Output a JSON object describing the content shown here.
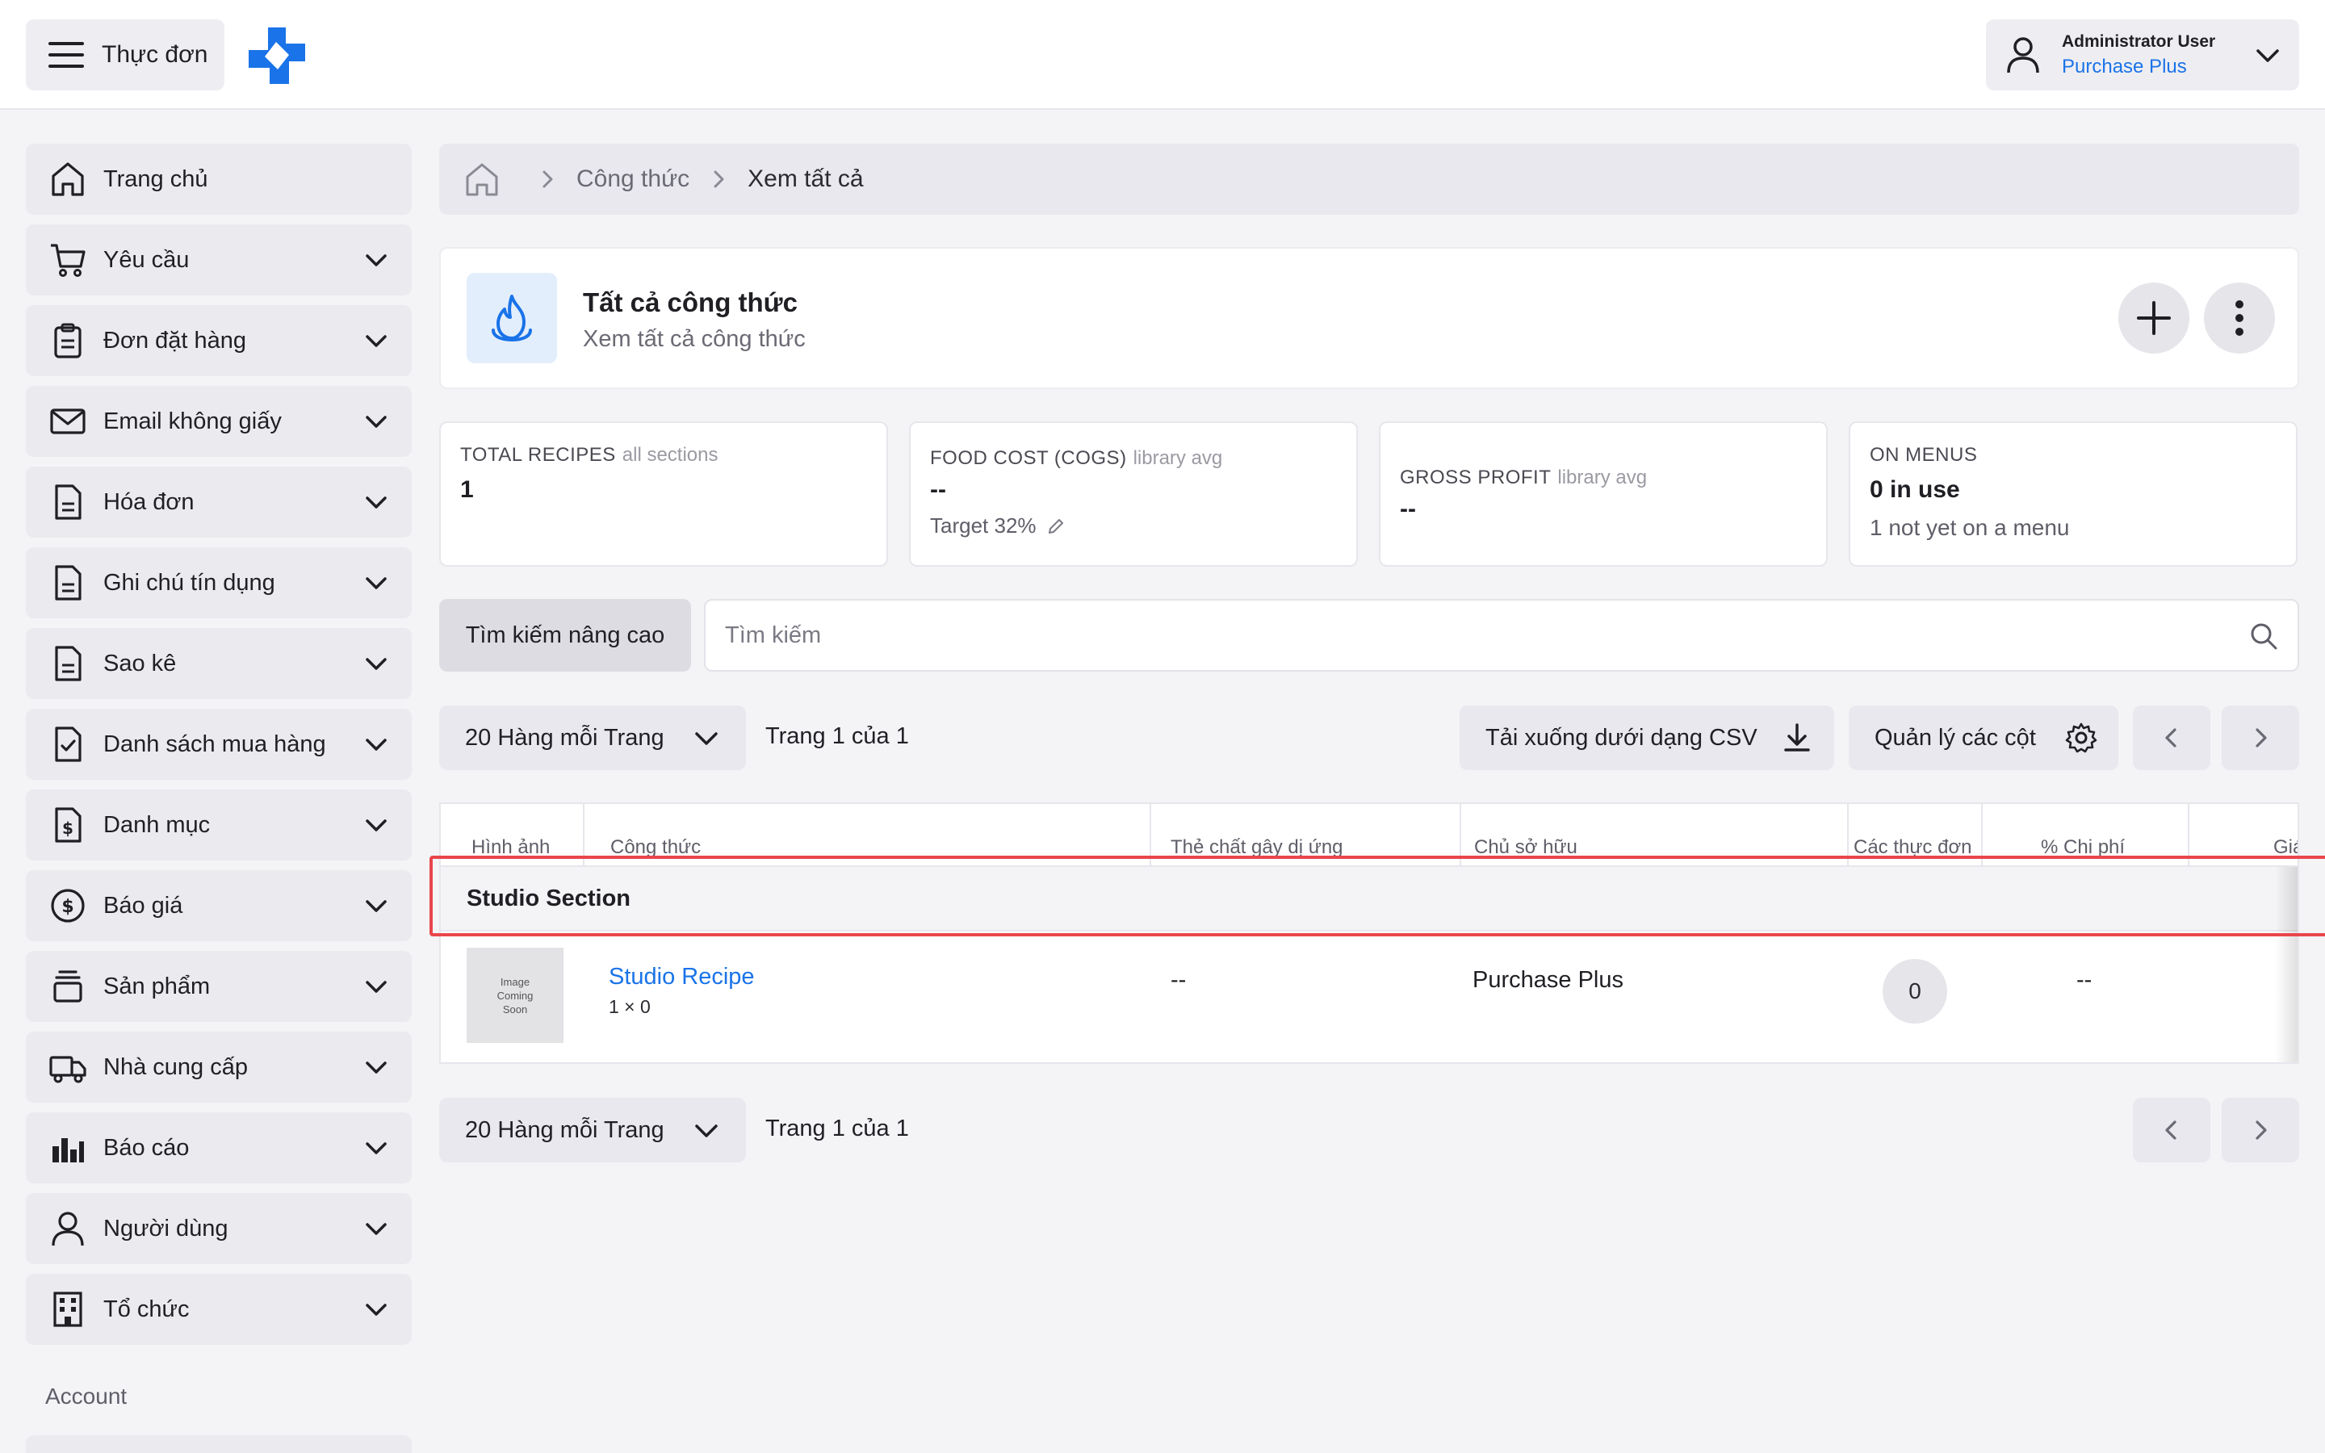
{
  "topbar": {
    "menu_label": "Thực đơn",
    "user_name": "Administrator User",
    "user_org": "Purchase Plus"
  },
  "sidebar": {
    "items": [
      {
        "label": "Trang chủ",
        "icon": "home-icon"
      },
      {
        "label": "Yêu cầu",
        "icon": "cart-icon"
      },
      {
        "label": "Đơn đặt hàng",
        "icon": "clipboard-icon"
      },
      {
        "label": "Email không giấy",
        "icon": "mail-icon"
      },
      {
        "label": "Hóa đơn",
        "icon": "document-icon"
      },
      {
        "label": "Ghi chú tín dụng",
        "icon": "document-icon"
      },
      {
        "label": "Sao kê",
        "icon": "document-icon"
      },
      {
        "label": "Danh sách mua hàng",
        "icon": "checklist-icon"
      },
      {
        "label": "Danh mục",
        "icon": "catalog-dollar-icon"
      },
      {
        "label": "Báo giá",
        "icon": "dollar-circle-icon"
      },
      {
        "label": "Sản phẩm",
        "icon": "product-stack-icon"
      },
      {
        "label": "Nhà cung cấp",
        "icon": "truck-icon"
      },
      {
        "label": "Báo cáo",
        "icon": "bar-chart-icon"
      },
      {
        "label": "Người dùng",
        "icon": "user-icon"
      },
      {
        "label": "Tổ chức",
        "icon": "building-icon"
      }
    ],
    "section_label": "Account"
  },
  "breadcrumb": {
    "items": [
      "Công thức",
      "Xem tất cả"
    ]
  },
  "header": {
    "title": "Tất cả công thức",
    "subtitle": "Xem tất cả công thức"
  },
  "stats": {
    "total_recipes": {
      "label": "TOTAL RECIPES",
      "note": "all sections",
      "value": "1"
    },
    "food_cost": {
      "label": "FOOD COST (COGS)",
      "note": "library avg",
      "value": "--",
      "target": "Target 32%"
    },
    "gross_profit": {
      "label": "GROSS PROFIT",
      "note": "library avg",
      "value": "--"
    },
    "on_menus": {
      "label": "ON MENUS",
      "value": "0 in use",
      "sub": "1 not yet on a menu"
    }
  },
  "search": {
    "advanced_label": "Tìm kiếm nâng cao",
    "placeholder": "Tìm kiếm"
  },
  "toolbar": {
    "rows_per_page": "20 Hàng mỗi Trang",
    "page_info": "Trang 1 của 1",
    "download_csv": "Tải xuống dưới dạng CSV",
    "manage_columns": "Quản lý các cột"
  },
  "table": {
    "columns": [
      "Hình ảnh",
      "Công thức",
      "Thẻ chất gây dị ứng",
      "Chủ sở hữu",
      "Các thực đơn",
      "% Chi phí",
      "Giá"
    ],
    "group_label": "Studio Section",
    "rows": [
      {
        "image_text": [
          "Image",
          "Coming",
          "Soon"
        ],
        "recipe": "Studio Recipe",
        "recipe_sub": "1 × 0",
        "allergens": "--",
        "owner": "Purchase Plus",
        "menus": "0",
        "cost_pct": "--"
      }
    ]
  },
  "footer": {
    "rows_per_page": "20 Hàng mỗi Trang",
    "page_info": "Trang 1 của 1"
  },
  "colors": {
    "accent": "#1a73e8",
    "highlight": "#e8464b"
  }
}
